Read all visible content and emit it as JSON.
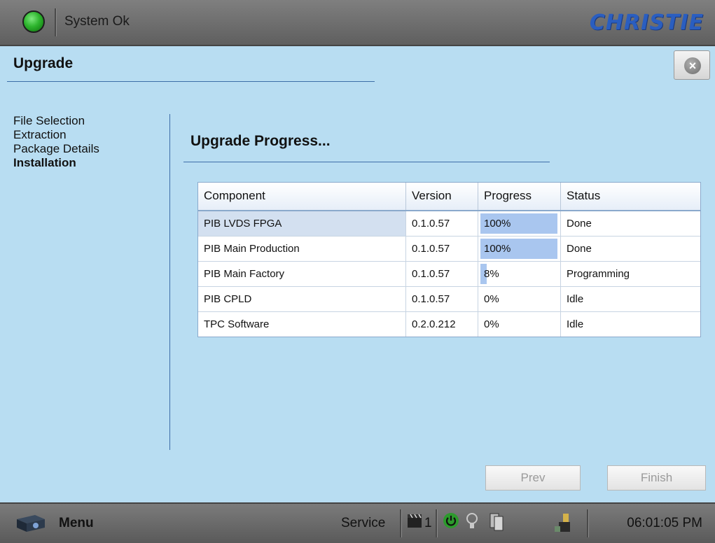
{
  "topbar": {
    "status_text": "System Ok",
    "brand": "CHRISTIE"
  },
  "header": {
    "title": "Upgrade",
    "close_symbol": "×"
  },
  "nav": {
    "items": [
      {
        "label": "File Selection",
        "active": false
      },
      {
        "label": "Extraction",
        "active": false
      },
      {
        "label": "Package Details",
        "active": false
      },
      {
        "label": "Installation",
        "active": true
      }
    ]
  },
  "content": {
    "title": "Upgrade Progress..."
  },
  "table": {
    "columns": [
      "Component",
      "Version",
      "Progress",
      "Status"
    ],
    "rows": [
      {
        "component": "PIB LVDS FPGA",
        "version": "0.1.0.57",
        "progress_text": "100%",
        "progress": 1.0,
        "status": "Done"
      },
      {
        "component": "PIB Main Production",
        "version": "0.1.0.57",
        "progress_text": "100%",
        "progress": 1.0,
        "status": "Done"
      },
      {
        "component": "PIB Main Factory",
        "version": "0.1.0.57",
        "progress_text": "8%",
        "progress": 0.08,
        "status": "Programming"
      },
      {
        "component": "PIB CPLD",
        "version": "0.1.0.57",
        "progress_text": "0%",
        "progress": 0.0,
        "status": "Idle"
      },
      {
        "component": "TPC Software",
        "version": "0.2.0.212",
        "progress_text": "0%",
        "progress": 0.0,
        "status": "Idle"
      }
    ]
  },
  "buttons": {
    "prev": "Prev",
    "finish": "Finish"
  },
  "bottombar": {
    "menu": "Menu",
    "service": "Service",
    "clapper_count": "1",
    "time": "06:01:05 PM"
  },
  "colors": {
    "status_ok": "#2eb52e",
    "progress_fill": "#a9c6ef",
    "brand": "#2a5ec0"
  }
}
